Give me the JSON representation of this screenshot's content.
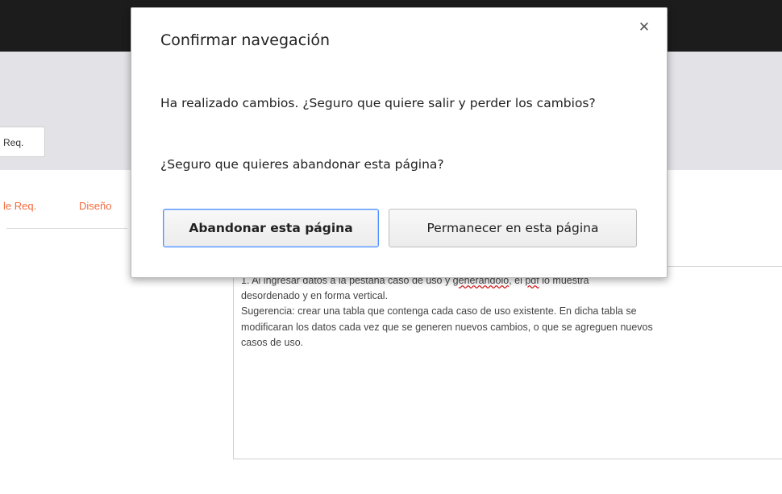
{
  "background": {
    "req_box_label": "Req.",
    "tabs": [
      "le Req.",
      "Diseño"
    ],
    "textarea": {
      "line1_prefix": "1.      Al ingresar datos a la pestaña caso de uso y ",
      "line1_squiggle1": "generandolo",
      "line1_mid": ", el ",
      "line1_squiggle2": "pdf",
      "line1_suffix": " lo muestra",
      "line2": "desordenado y en forma vertical.",
      "line3": "Sugerencia: crear una tabla que contenga cada caso de uso existente. En dicha tabla se",
      "line4": "modificaran los datos cada vez que se generen nuevos cambios, o que se agreguen nuevos",
      "line5": "casos de uso."
    }
  },
  "dialog": {
    "title": "Confirmar navegación",
    "close_icon": "close-icon",
    "message": "Ha realizado cambios. ¿Seguro que quiere salir y perder los cambios?",
    "question": "¿Seguro que quieres abandonar esta página?",
    "leave_button": "Abandonar esta página",
    "stay_button": "Permanecer en esta página"
  },
  "colors": {
    "topbar": "#1c1c1c",
    "tab_accent": "#f26a3d",
    "focus_border": "#4d90fe"
  }
}
